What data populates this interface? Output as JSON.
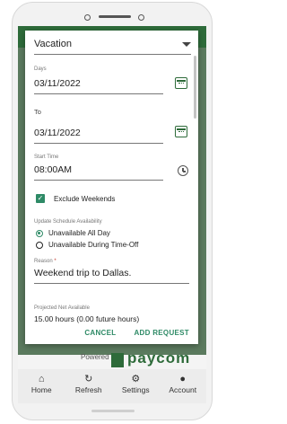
{
  "dialog": {
    "type_value": "Vacation",
    "days_label": "Days",
    "days_value": "03/11/2022",
    "to_label": "To",
    "to_value": "03/11/2022",
    "start_time_label": "Start Time",
    "start_time_value": "08:00AM",
    "exclude_weekends_label": "Exclude Weekends",
    "availability_label": "Update Schedule Availability",
    "availability_options": [
      "Unavailable All Day",
      "Unavailable During Time-Off"
    ],
    "reason_label": "Reason",
    "reason_required_mark": "*",
    "reason_value": "Weekend trip to Dallas.",
    "projected_label": "Projected Net Available",
    "projected_value": "15.00 hours (0.00 future hours)",
    "cancel_label": "CANCEL",
    "add_label": "ADD REQUEST"
  },
  "background": {
    "powered_text": "Powered by",
    "logo_text": "paycom"
  },
  "nav": {
    "items": [
      {
        "label": "Home",
        "icon": "home-icon"
      },
      {
        "label": "Refresh",
        "icon": "refresh-icon"
      },
      {
        "label": "Settings",
        "icon": "gear-icon"
      },
      {
        "label": "Account",
        "icon": "account-icon"
      }
    ]
  },
  "colors": {
    "brand": "#2e6b3a",
    "accent": "#2e8a66"
  }
}
